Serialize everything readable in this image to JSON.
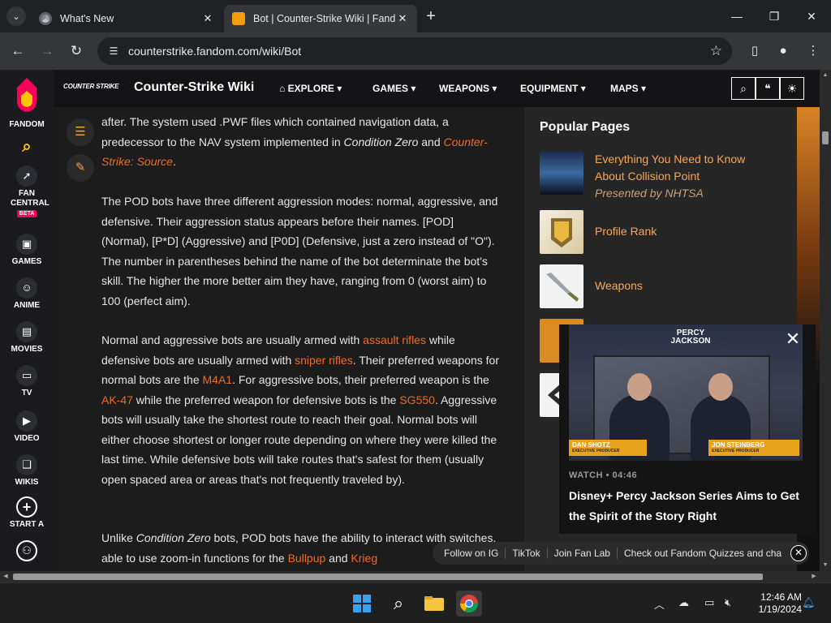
{
  "browser": {
    "tabs": [
      {
        "title": "What's New",
        "active": false
      },
      {
        "title": "Bot | Counter-Strike Wiki | Fand",
        "active": true
      }
    ],
    "url": "counterstrike.fandom.com/wiki/Bot"
  },
  "fandom_rail": {
    "items": [
      {
        "label": "FANDOM",
        "icon": "fandom-logo-icon"
      },
      {
        "label": "",
        "icon": "search-icon"
      },
      {
        "label": "FAN CENTRAL",
        "icon": "rocket-icon",
        "badge": "BETA"
      },
      {
        "label": "GAMES",
        "icon": "gamepad-icon"
      },
      {
        "label": "ANIME",
        "icon": "anime-face-icon"
      },
      {
        "label": "MOVIES",
        "icon": "clapperboard-icon"
      },
      {
        "label": "TV",
        "icon": "tv-icon"
      },
      {
        "label": "VIDEO",
        "icon": "play-icon"
      },
      {
        "label": "WIKIS",
        "icon": "book-icon"
      },
      {
        "label": "START A",
        "icon": "plus-circle-icon"
      },
      {
        "label": "",
        "icon": "user-icon"
      }
    ]
  },
  "wiki_header": {
    "logo_text": "COUNTER STRIKE",
    "name": "Counter-Strike Wiki",
    "nav": [
      "EXPLORE",
      "GAMES",
      "WEAPONS",
      "EQUIPMENT",
      "MAPS"
    ]
  },
  "article": {
    "p1": {
      "a": "after. The system used .PWF files which contained navigation data, a predecessor to the NAV system implemented in ",
      "i1": "Condition Zero",
      "b": " and ",
      "link": "Counter-Strike: Source",
      "c": "."
    },
    "p2": "The POD bots have three different aggression modes: normal, aggressive, and defensive. Their aggression status appears before their names. [POD] (Normal), [P*D] (Aggressive) and [P0D] (Defensive, just a zero instead of \"O\"). The number in parentheses behind the name of the bot determinate the bot's skill. The higher the more better aim they have, ranging from 0 (worst aim) to 100 (perfect aim).",
    "p3": {
      "a": "Normal and aggressive bots are usually armed with ",
      "l1": "assault rifles",
      "b": " while defensive bots are usually armed with ",
      "l2": "sniper rifles",
      "c": ". Their preferred weapons for normal bots are the ",
      "l3": "M4A1",
      "d": ". For aggressive bots, their preferred weapon is the ",
      "l4": "AK-47",
      "e": " while the preferred weapon for defensive bots is the ",
      "l5": "SG550",
      "f": ". Aggressive bots will usually take the shortest route to reach their goal. Normal bots will either choose shortest or longer route depending on where they were killed the last time. While defensive bots will take routes that's safest for them (usually open spaced area or areas that's not frequently traveled by)."
    },
    "p4": {
      "a": "Unlike ",
      "i1": "Condition Zero",
      "b": " bots, POD bots have the ability to interact with switches, able to use zoom-in functions for the ",
      "l1": "Bullpup",
      "c": " and ",
      "l2": "Krieg"
    }
  },
  "popular_pages": {
    "title": "Popular Pages",
    "items": [
      {
        "title": "Everything You Need to Know About Collision Point",
        "sub": "Presented by NHTSA"
      },
      {
        "title": "Profile Rank",
        "sub": ""
      },
      {
        "title": "Weapons",
        "sub": ""
      }
    ]
  },
  "video": {
    "brand": "PERCY JACKSON",
    "name_left": "DAN SHOTZ",
    "name_left_role": "EXECUTIVE PRODUCER",
    "name_right": "JON STEINBERG",
    "name_right_role": "EXECUTIVE PRODUCER",
    "meta": "WATCH • 04:46",
    "title": "Disney+ Percy Jackson Series Aims to Get the Spirit of the Story Right"
  },
  "pillbar": [
    "Follow on IG",
    "TikTok",
    "Join Fan Lab",
    "Check out Fandom Quizzes and cha"
  ],
  "taskbar": {
    "time": "12:46 AM",
    "date": "1/19/2024"
  },
  "colors": {
    "accent_link": "#f26a21",
    "fandom_pink": "#fa005a",
    "chrome_dark": "#202124"
  }
}
